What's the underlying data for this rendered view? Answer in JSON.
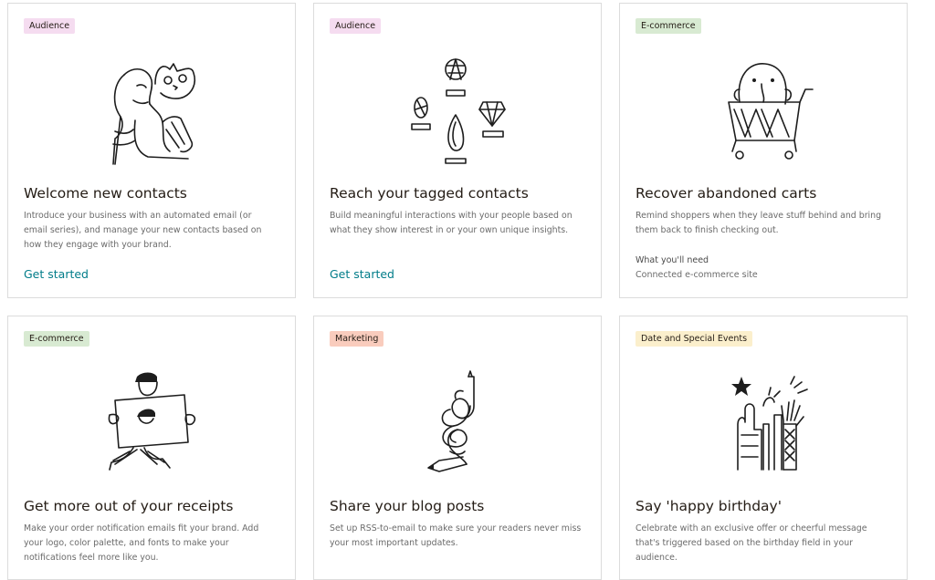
{
  "cards": [
    {
      "tag": "Audience",
      "title": "Welcome new contacts",
      "description": "Introduce your business with an automated email (or email series), and manage your new contacts based on how they engage with your brand.",
      "action": "Get started",
      "illustration": "person-with-cat-illustration"
    },
    {
      "tag": "Audience",
      "title": "Reach your tagged contacts",
      "description": "Build meaningful interactions with your people based on what they show interest in or your own unique insights.",
      "action": "Get started",
      "illustration": "gems-illustration"
    },
    {
      "tag": "E-commerce",
      "title": "Recover abandoned carts",
      "description": "Remind shoppers when they leave stuff behind and bring them back to finish checking out.",
      "need_label": "What you'll need",
      "need_value": "Connected e-commerce site",
      "illustration": "shopping-cart-illustration"
    },
    {
      "tag": "E-commerce",
      "title": "Get more out of your receipts",
      "description": "Make your order notification emails fit your brand. Add your logo, color palette, and fonts to make your notifications feel more like you.",
      "illustration": "running-man-with-sign-illustration"
    },
    {
      "tag": "Marketing",
      "title": "Share your blog posts",
      "description": "Set up RSS-to-email to make sure your readers never miss your most important updates.",
      "illustration": "knotted-pencil-illustration"
    },
    {
      "tag": "Date and Special Events",
      "title": "Say 'happy birthday'",
      "description": "Celebrate with an exclusive offer or cheerful message that's triggered based on the birthday field in your audience.",
      "illustration": "celebration-hands-illustration"
    }
  ],
  "colors": {
    "link": "#007c89",
    "tag_audience": "#f5dcf0",
    "tag_ecommerce": "#d8ead2",
    "tag_marketing": "#f9ccbd",
    "tag_date": "#fbefcc"
  }
}
